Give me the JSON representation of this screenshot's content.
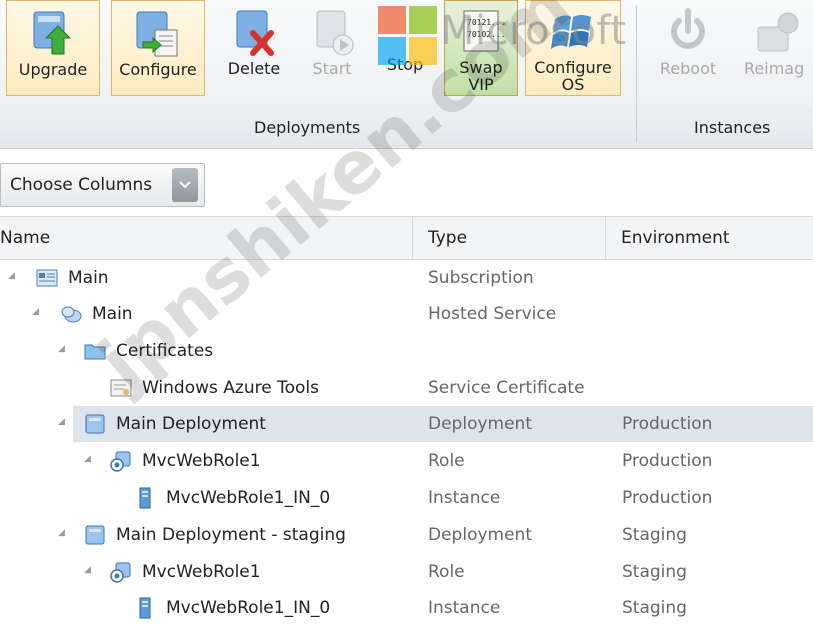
{
  "ribbon": {
    "buttons": [
      {
        "label": "Upgrade",
        "icon": "upgrade-icon"
      },
      {
        "label": "Configure",
        "icon": "configure-icon"
      },
      {
        "label": "Delete",
        "icon": "delete-icon"
      },
      {
        "label": "Start",
        "icon": "start-icon"
      },
      {
        "label": "Stop",
        "icon": "stop-icon"
      },
      {
        "label": "Swap\nVIP",
        "icon": "swap-vip-icon"
      },
      {
        "label": "Configure\nOS",
        "icon": "configure-os-icon"
      },
      {
        "label": "Reboot",
        "icon": "reboot-icon"
      },
      {
        "label": "Reimag",
        "icon": "reimage-icon"
      }
    ],
    "groups": {
      "deployments": "Deployments",
      "instances": "Instances"
    },
    "swap_icon_text": [
      "70121...",
      "70102..."
    ]
  },
  "watermark": {
    "brand": "Microsoft",
    "site": "jpnshiken.com"
  },
  "choose_columns": {
    "label": "Choose Columns"
  },
  "grid": {
    "headers": {
      "name": "Name",
      "type": "Type",
      "environment": "Environment"
    },
    "rows": [
      {
        "name": "Main",
        "type": "Subscription",
        "env": ""
      },
      {
        "name": "Main",
        "type": "Hosted Service",
        "env": ""
      },
      {
        "name": "Certificates",
        "type": "",
        "env": ""
      },
      {
        "name": "Windows Azure Tools",
        "type": "Service Certificate",
        "env": ""
      },
      {
        "name": "Main Deployment",
        "type": "Deployment",
        "env": "Production"
      },
      {
        "name": "MvcWebRole1",
        "type": "Role",
        "env": "Production"
      },
      {
        "name": "MvcWebRole1_IN_0",
        "type": "Instance",
        "env": "Production"
      },
      {
        "name": "Main Deployment - staging",
        "type": "Deployment",
        "env": "Staging"
      },
      {
        "name": "MvcWebRole1",
        "type": "Role",
        "env": "Staging"
      },
      {
        "name": "MvcWebRole1_IN_0",
        "type": "Instance",
        "env": "Staging"
      }
    ]
  },
  "colors": {
    "selected_row": "#dfe4ec",
    "ribbon_selected_border": "#e2b463",
    "swap_active": "#bfe0a8"
  }
}
